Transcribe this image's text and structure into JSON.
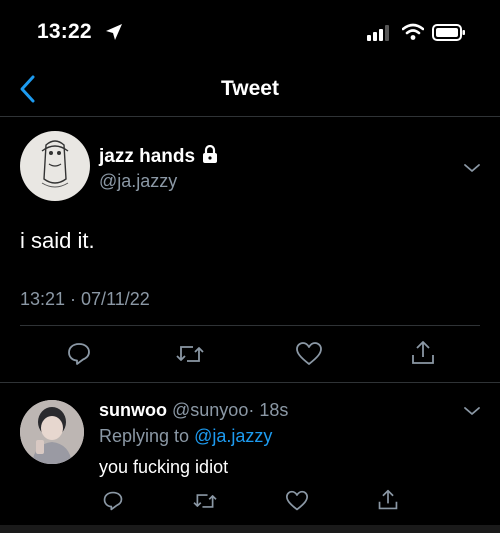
{
  "status_bar": {
    "time": "13:22"
  },
  "header": {
    "title": "Tweet"
  },
  "tweet": {
    "author_name": "jazz hands",
    "author_handle": "@ja.jazzy",
    "text": "i said it.",
    "timestamp": "13:21 · 07/11/22"
  },
  "reply": {
    "author_name": "sunwoo",
    "author_handle": "@sunyoo",
    "time_ago": "· 18s",
    "replying_prefix": "Replying to",
    "replying_handle": "@ja.jazzy",
    "text": "you fucking idiot"
  },
  "colors": {
    "accent": "#1d9bf0",
    "secondary_text": "#8b98a5",
    "background": "#000000"
  }
}
